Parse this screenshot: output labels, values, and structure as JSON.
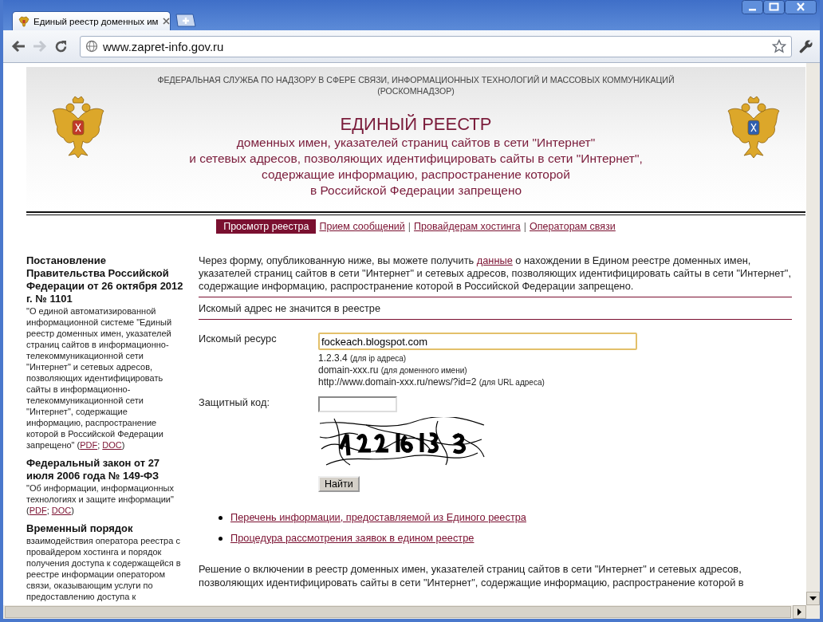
{
  "browser": {
    "tab_title": "Единый реестр доменных им",
    "address": "www.zapret-info.gov.ru"
  },
  "header": {
    "agency": "ФЕДЕРАЛЬНАЯ СЛУЖБА ПО НАДЗОРУ В СФЕРЕ СВЯЗИ, ИНФОРМАЦИОННЫХ ТЕХНОЛОГИЙ И МАССОВЫХ КОММУНИКАЦИЙ",
    "agency_short": "(РОСКОМНАДЗОР)",
    "title": "ЕДИНЫЙ РЕЕСТР",
    "subtitle_lines": [
      "доменных имен, указателей страниц сайтов в сети \"Интернет\"",
      "и сетевых адресов, позволяющих идентифицировать сайты в сети \"Интернет\",",
      "содержащие информацию, распространение которой",
      "в Российской Федерации запрещено"
    ]
  },
  "nav": {
    "separator": "|",
    "items": [
      {
        "label": "Просмотр реестра",
        "selected": true
      },
      {
        "label": "Прием сообщений",
        "selected": false
      },
      {
        "label": "Провайдерам хостинга",
        "selected": false
      },
      {
        "label": "Операторам связи",
        "selected": false
      }
    ]
  },
  "sidebar": [
    {
      "title": "Постановление Правительства Российской Федерации от 26 октября 2012 г. № 1101",
      "description": "\"О единой автоматизированной информационной системе \"Единый реестр доменных имен, указателей страниц сайтов в информационно-телекоммуникационной сети \"Интернет\" и сетевых адресов, позволяющих идентифицировать сайты в информационно-телекоммуникационной сети \"Интернет\", содержащие информацию, распространение которой в Российской Федерации запрещено\" (",
      "links": [
        "PDF",
        "DOC"
      ],
      "links_separator": "; ",
      "links_close": ")"
    },
    {
      "title": "Федеральный закон от 27 июля 2006 года № 149-ФЗ",
      "description": "\"Об информации, информационных технологиях и защите информации\" (",
      "links": [
        "PDF",
        "DOC"
      ],
      "links_separator": "; ",
      "links_close": ")"
    },
    {
      "title": "Временный порядок",
      "description": "взаимодействия оператора реестра с провайдером хостинга и порядок получения доступа к содержащейся в реестре информации оператором связи, оказывающим услуги по предоставлению доступа к"
    }
  ],
  "intro": {
    "before": "Через форму, опубликованную ниже, вы можете получить ",
    "link": "данные",
    "after": " о нахождении в Едином реестре доменных имен, указателей страниц сайтов в сети \"Интернет\" и сетевых адресов, позволяющих идентифицировать сайты в сети \"Интернет\", содержащие информацию, распространение которой в Российской Федерации запрещено."
  },
  "status_message": "Искомый адрес не значится в реестре",
  "form": {
    "resource_label": "Искомый ресурс",
    "resource_value": "fockeach.blogspot.com",
    "resource_focused": true,
    "examples": [
      {
        "value": "1.2.3.4",
        "hint": "(для ip адреса)"
      },
      {
        "value": "domain-xxx.ru",
        "hint": "(для доменного имени)"
      },
      {
        "value": "http://www.domain-xxx.ru/news/?id=2",
        "hint": "(для URL адреса)"
      }
    ],
    "code_label": "Защитный код:",
    "submit": "Найти"
  },
  "links": [
    "Перечень информации, предоставляемой из Единого реестра",
    "Процедура рассмотрения заявок в едином реестре"
  ],
  "footer_lines": [
    "Решение о включении в реестр доменных имен, указателей страниц сайтов в сети \"Интернет\" и сетевых адресов,",
    "позволяющих идентифицировать сайты в сети \"Интернет\", содержащие информацию, распространение которой в"
  ]
}
